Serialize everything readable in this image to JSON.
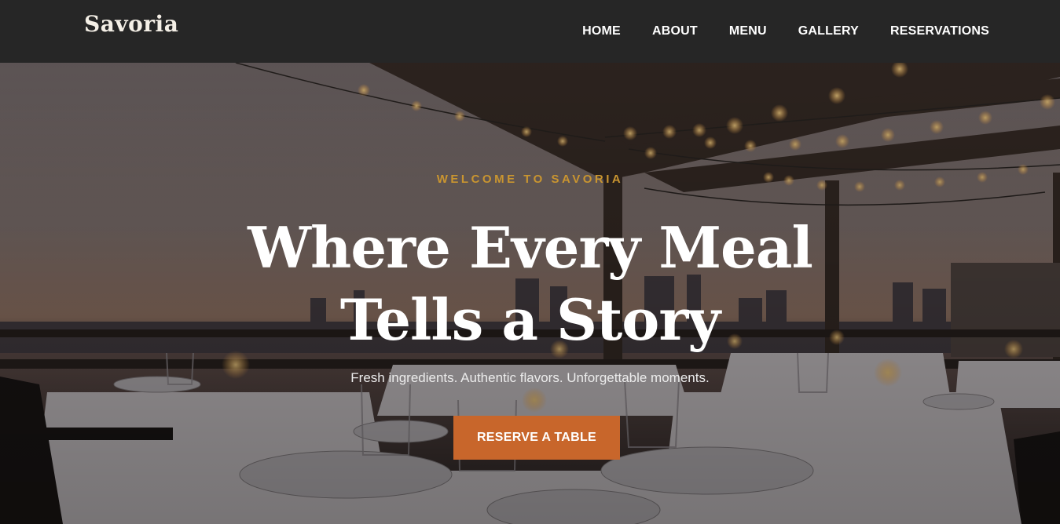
{
  "brand": {
    "name": "Savoria"
  },
  "nav": {
    "items": [
      {
        "label": "HOME"
      },
      {
        "label": "ABOUT"
      },
      {
        "label": "MENU"
      },
      {
        "label": "GALLERY"
      },
      {
        "label": "RESERVATIONS"
      }
    ]
  },
  "hero": {
    "eyebrow": "WELCOME TO SAVORIA",
    "headline_line1": "Where Every Meal",
    "headline_line2": "Tells a Story",
    "subtext": "Fresh ingredients. Authentic flavors. Unforgettable moments.",
    "cta_label": "RESERVE A TABLE"
  },
  "colors": {
    "navbar_bg": "#262626",
    "accent_gold": "#c99530",
    "cta_orange": "#c8662b",
    "text_light": "#ffffff"
  }
}
